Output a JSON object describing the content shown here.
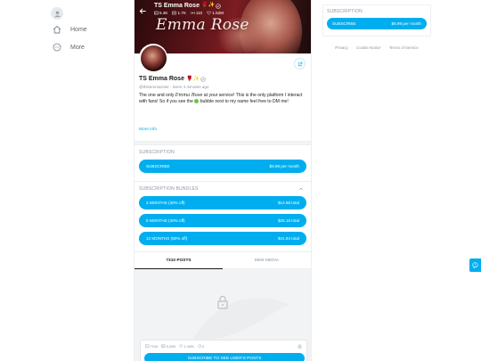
{
  "nav": {
    "items": [
      {
        "label": "Home",
        "icon": "home-icon"
      },
      {
        "label": "More",
        "icon": "more-icon"
      }
    ]
  },
  "profile": {
    "header_name": "TS Emma Rose",
    "name_emoji": "🌹✨",
    "stats": {
      "photos": "5.3K",
      "videos": "1.7K",
      "streams": "110",
      "likes": "1.52M"
    },
    "cover_signature": "Emma Rose",
    "display_name": "TS Emma Rose",
    "handle": "@thisemmarose",
    "last_seen": "Seen 4 minutes ago",
    "bio_part1": "The one and only ",
    "bio_script": "Emma Rose",
    "bio_part2": " at your service! This is the only platform I interact with fans! So if you see the ",
    "bio_part3": " bubble next to my name feel free to DM me!",
    "more_info": "More info"
  },
  "subscription": {
    "title": "SUBSCRIPTION",
    "subscribe_label": "SUBSCRIBE",
    "price": "$6.99 per month"
  },
  "bundles": {
    "title": "SUBSCRIPTION BUNDLES",
    "items": [
      {
        "label": "3 MONTHS (30% off)",
        "price": "$14.68 total"
      },
      {
        "label": "6 MONTHS (40% off)",
        "price": "$25.16 total"
      },
      {
        "label": "12 MONTHS (50% off)",
        "price": "$41.94 total"
      }
    ]
  },
  "tabs": [
    {
      "label": "7310 POSTS"
    },
    {
      "label": "6965 MEDIA"
    }
  ],
  "locked_post": {
    "stats": [
      {
        "icon": "image-icon",
        "value": "7010"
      },
      {
        "icon": "video-icon",
        "value": "5,565"
      },
      {
        "icon": "heart-icon",
        "value": "1.44M"
      },
      {
        "icon": "comment-icon",
        "value": "0"
      }
    ],
    "button_label": "SUBSCRIBE TO SEE USER'S POSTS"
  },
  "right_panel": {
    "title": "SUBSCRIPTION",
    "subscribe_label": "SUBSCRIBE",
    "price": "$6.99 per month",
    "footer": [
      "Privacy",
      "Cookie Notice",
      "Terms of Service"
    ]
  },
  "colors": {
    "accent": "#00aeef",
    "muted": "#8a96a3"
  }
}
